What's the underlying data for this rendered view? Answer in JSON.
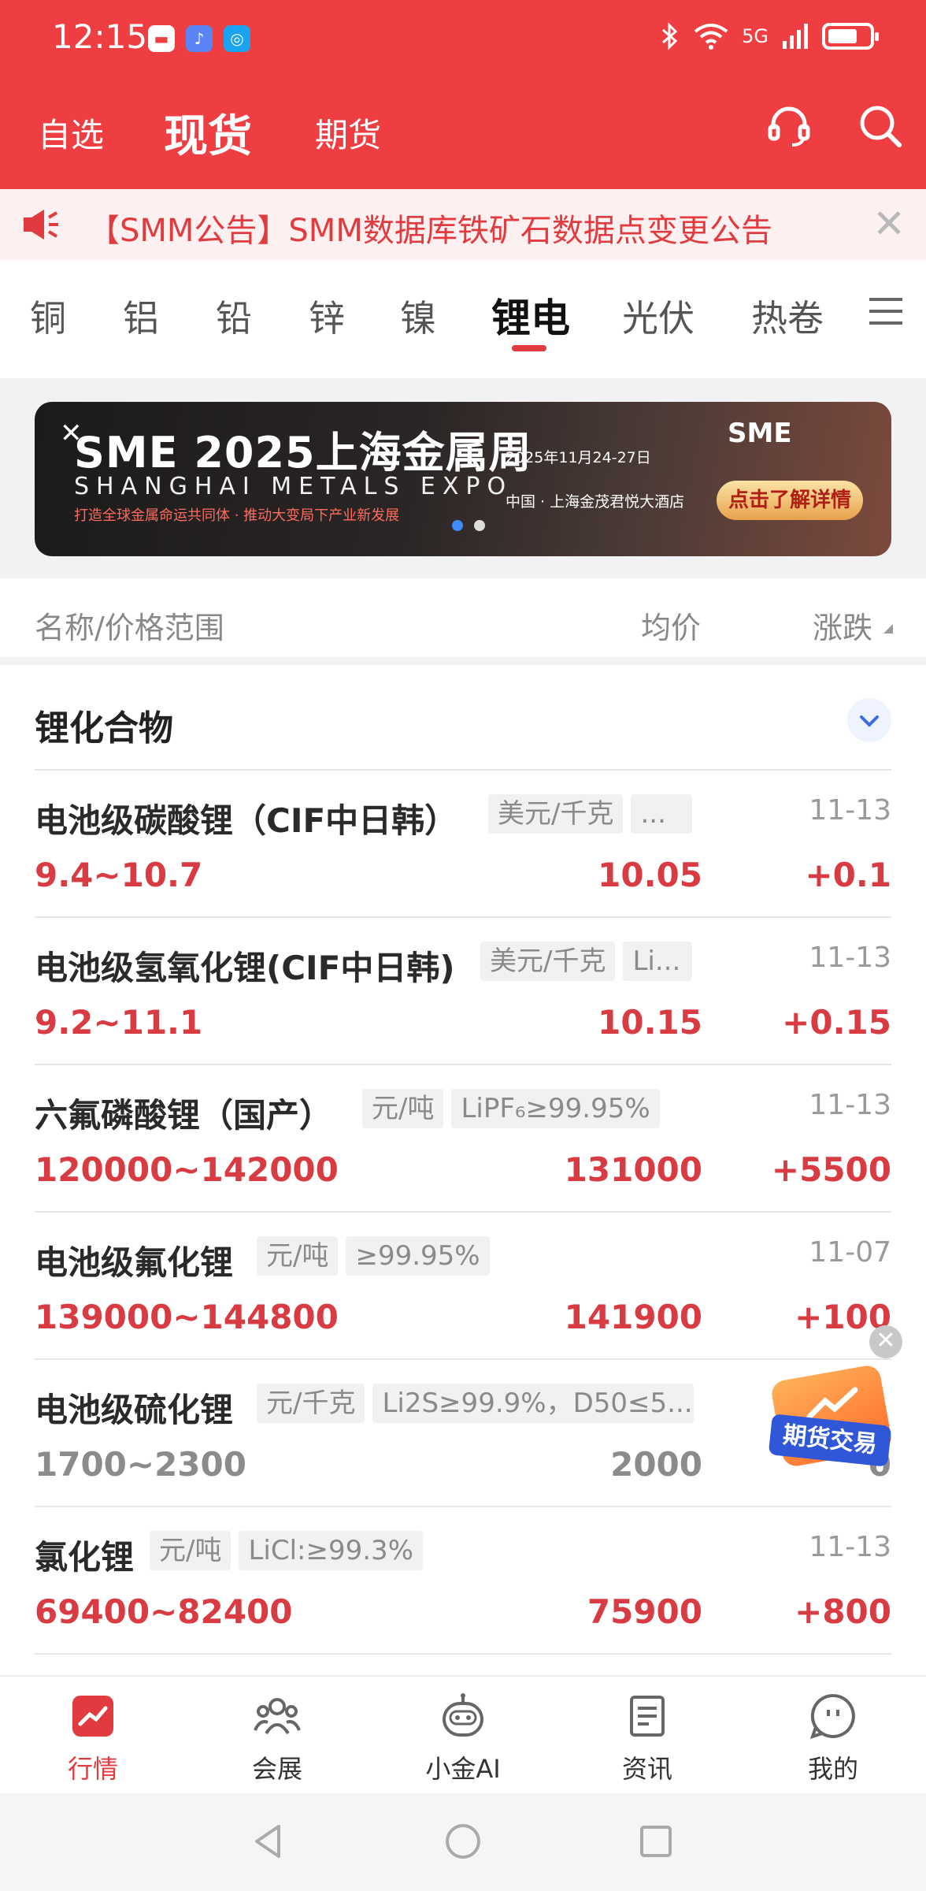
{
  "status_bar": {
    "time": "12:15",
    "network": "5G"
  },
  "header": {
    "tabs": [
      "自选",
      "现货",
      "期货"
    ],
    "active_tab": "现货",
    "accent_color": "#ef3e42"
  },
  "notice": {
    "text": "【SMM公告】SMM数据库铁矿石数据点变更公告"
  },
  "categories": {
    "items": [
      "铜",
      "铝",
      "铅",
      "锌",
      "镍",
      "锂电",
      "光伏",
      "热卷"
    ],
    "active": "锂电"
  },
  "banner": {
    "title": "SME 2025上海金属周",
    "subtitle": "SHANGHAI METALS EXPO",
    "slogan": "打造全球金属命运共同体 · 推动大变局下产业新发展",
    "date": "2025年11月24-27日",
    "location": "中国 · 上海金茂君悦大酒店",
    "brand": "SME",
    "cta": "点击了解详情",
    "dots": 2,
    "active_dot": 0
  },
  "list_header": {
    "name": "名称/价格范围",
    "avg": "均价",
    "change": "涨跌"
  },
  "section": {
    "title": "锂化合物"
  },
  "rows": [
    {
      "name": "电池级碳酸锂（CIF中日韩）",
      "tags": [
        "美元/千克",
        "..."
      ],
      "date": "11-13",
      "range": "9.4~10.7",
      "avg": "10.05",
      "change": "+0.1",
      "trend": "up"
    },
    {
      "name": "电池级氢氧化锂(CIF中日韩)",
      "tags": [
        "美元/千克",
        "Li..."
      ],
      "date": "11-13",
      "range": "9.2~11.1",
      "avg": "10.15",
      "change": "+0.15",
      "trend": "up"
    },
    {
      "name": "六氟磷酸锂（国产）",
      "tags": [
        "元/吨",
        "LiPF₆≥99.95%"
      ],
      "date": "11-13",
      "range": "120000~142000",
      "avg": "131000",
      "change": "+5500",
      "trend": "up"
    },
    {
      "name": "电池级氟化锂",
      "tags": [
        "元/吨",
        "≥99.95%"
      ],
      "date": "11-07",
      "range": "139000~144800",
      "avg": "141900",
      "change": "+100",
      "trend": "up"
    },
    {
      "name": "电池级硫化锂",
      "tags": [
        "元/千克",
        "Li2S≥99.9%，D50≤5..."
      ],
      "date": "",
      "range": "1700~2300",
      "avg": "2000",
      "change": "0",
      "trend": "flat"
    },
    {
      "name": "氯化锂",
      "tags": [
        "元/吨",
        "LiCl:≥99.3%"
      ],
      "date": "11-13",
      "range": "69400~82400",
      "avg": "75900",
      "change": "+800",
      "trend": "up"
    }
  ],
  "promo": {
    "label": "期货交易"
  },
  "tabbar": {
    "items": [
      "行情",
      "会展",
      "小金AI",
      "资讯",
      "我的"
    ],
    "active": "行情"
  }
}
